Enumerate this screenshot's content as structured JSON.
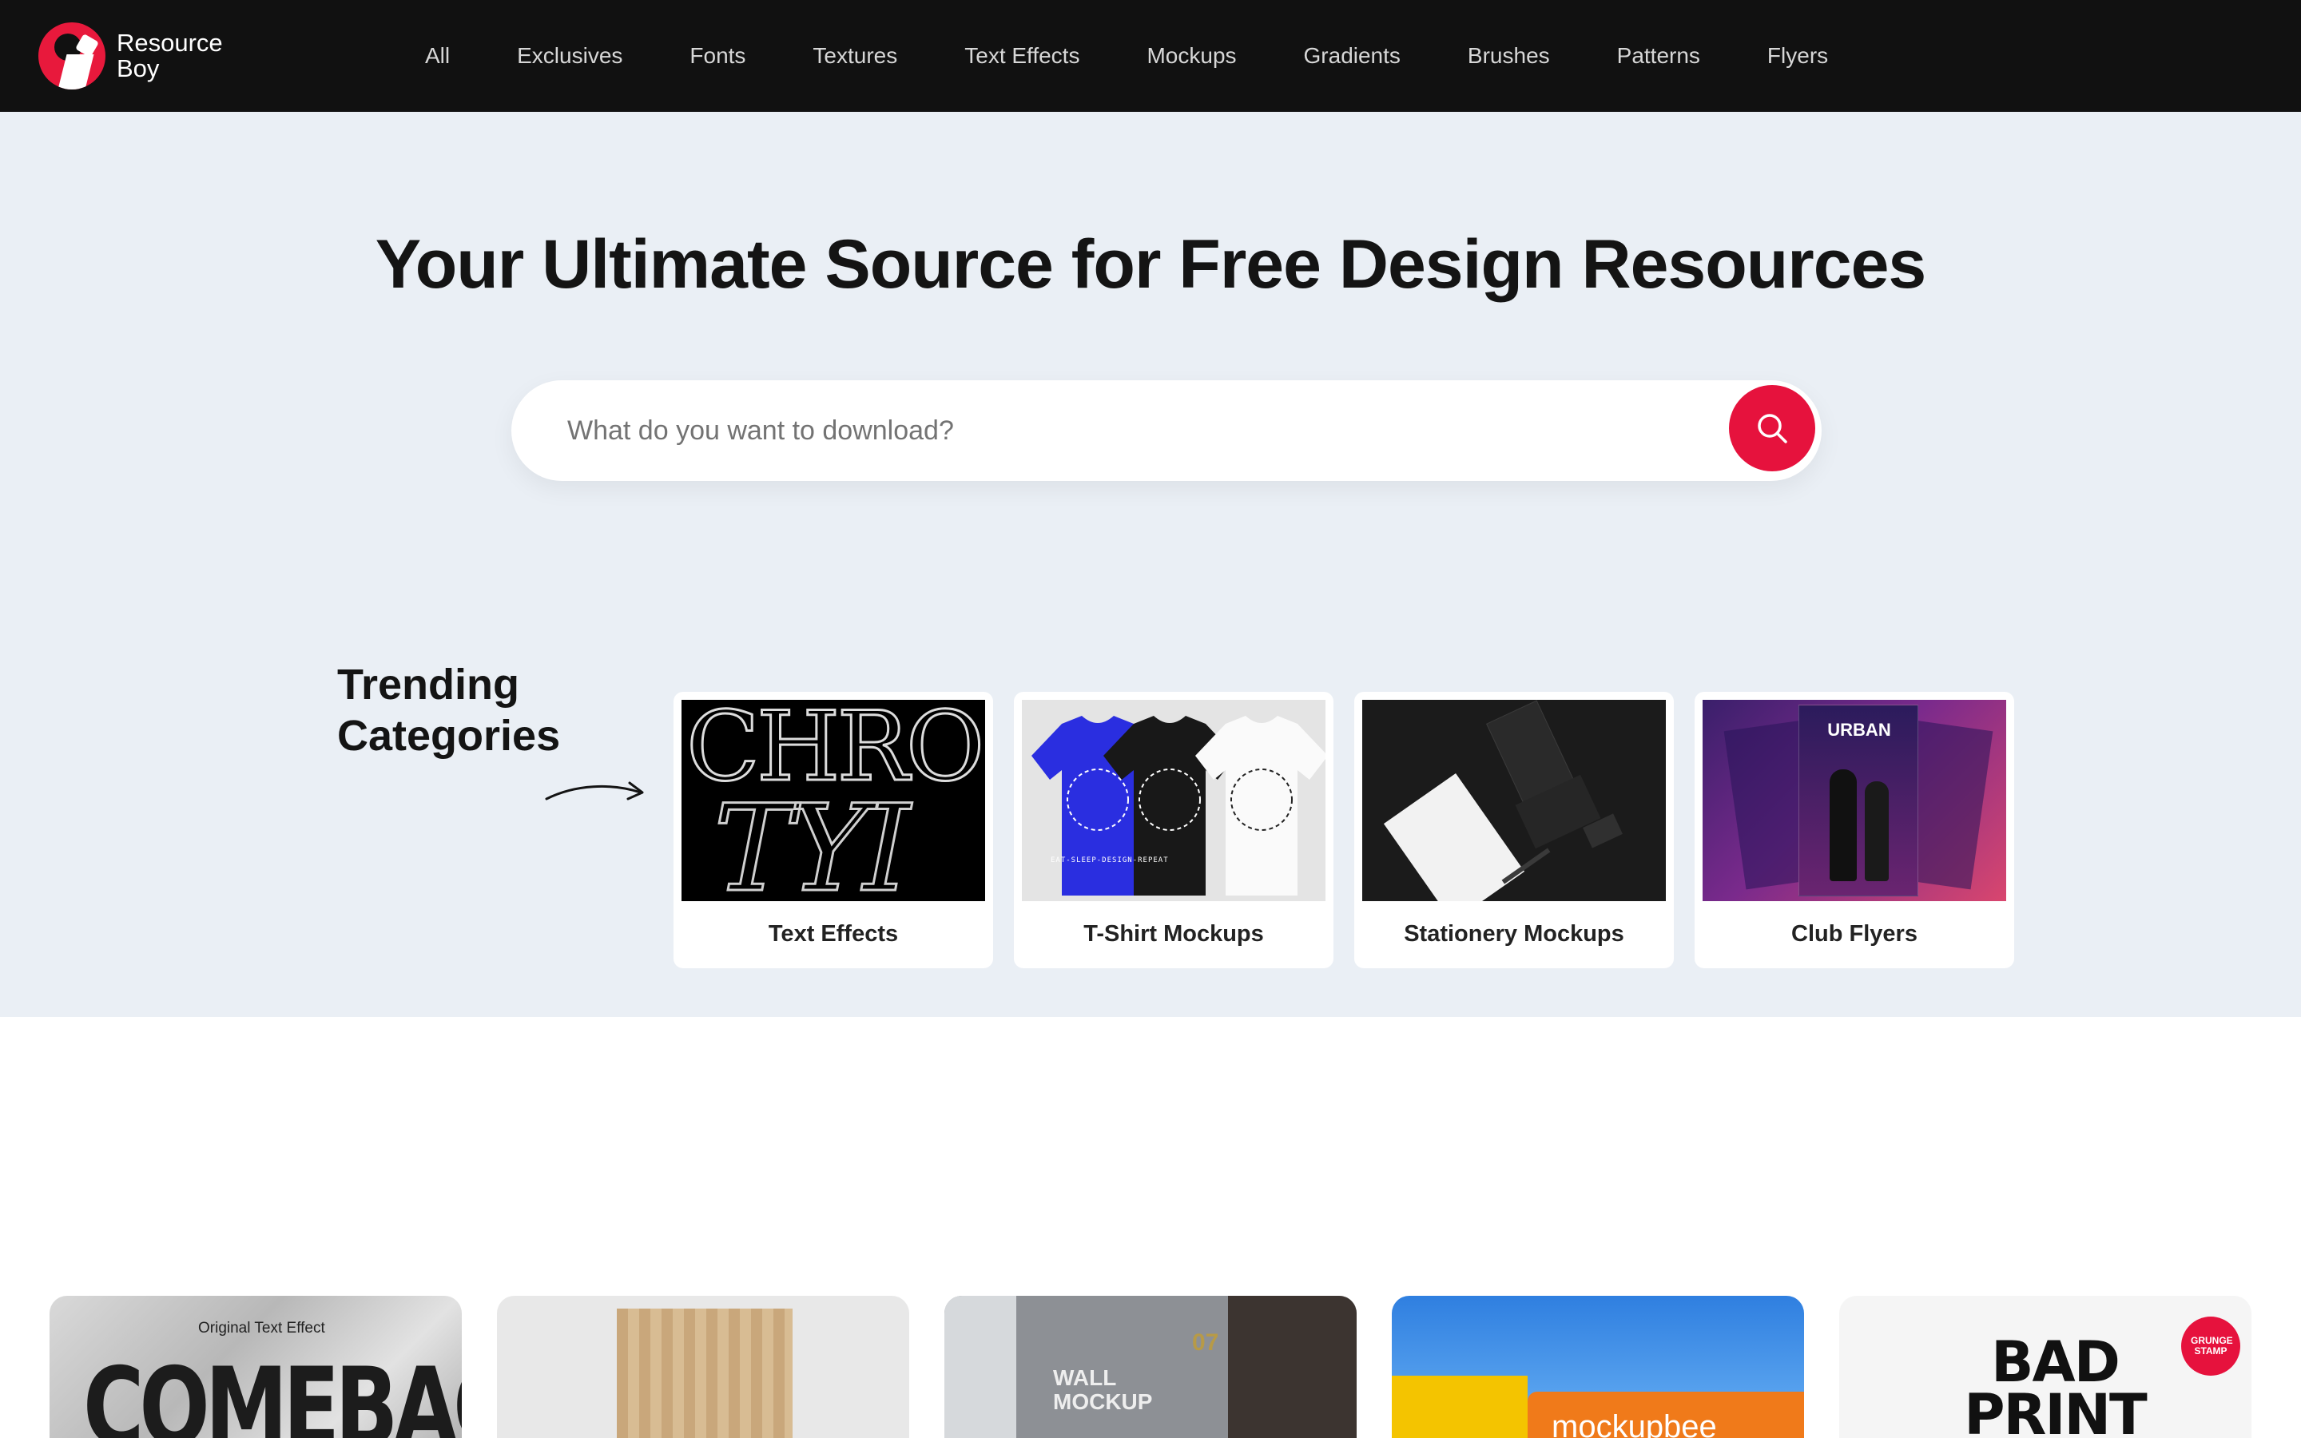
{
  "brand": {
    "name_line1": "Resource",
    "name_line2": "Boy",
    "logo_color": "#e8193c"
  },
  "nav": {
    "links": [
      "All",
      "Exclusives",
      "Fonts",
      "Textures",
      "Text Effects",
      "Mockups",
      "Gradients",
      "Brushes",
      "Patterns",
      "Flyers"
    ]
  },
  "hero": {
    "title": "Your Ultimate Source for Free Design Resources",
    "search": {
      "placeholder": "What do you want to download?",
      "button_icon": "search-icon",
      "button_color": "#e6123d"
    },
    "trending": {
      "line1": "Trending",
      "line2": "Categories"
    },
    "categories": [
      {
        "label": "Text Effects",
        "art_text_1": "CHRO",
        "art_text_2": "TYI"
      },
      {
        "label": "T-Shirt Mockups",
        "art_text": "EAT-SLEEP-DESIGN-REPEAT"
      },
      {
        "label": "Stationery Mockups"
      },
      {
        "label": "Club Flyers",
        "art_text": "URBAN"
      }
    ]
  },
  "featured": {
    "cards": [
      {
        "small_text": "Original Text Effect",
        "big_text": "COMEBACK"
      },
      {
        "art": "paper-bag"
      },
      {
        "big_text": "WALL MOCKUP",
        "number": "07"
      },
      {
        "big_text": "mockupbee"
      },
      {
        "big_text": "BAD PRINT",
        "badge": "GRUNGE STAMP"
      }
    ]
  },
  "colors": {
    "nav_bg": "#111111",
    "hero_bg": "#eaeff5",
    "accent": "#e6123d"
  }
}
